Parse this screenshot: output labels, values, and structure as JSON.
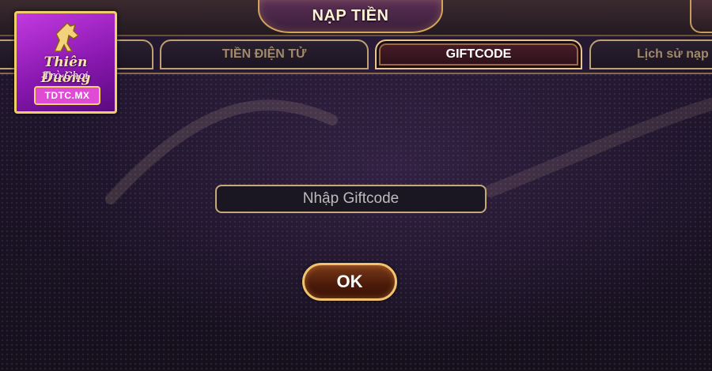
{
  "header": {
    "title": "NẠP TIỀN"
  },
  "tabs": [
    {
      "label": ""
    },
    {
      "label": "TIỀN ĐIỆN TỬ"
    },
    {
      "label": "GIFTCODE",
      "active": true
    },
    {
      "label": "Lịch sử nạp"
    }
  ],
  "logo": {
    "brand": "Thiên Đường",
    "sub": "Trò Chơi",
    "domain": "TDTC.MX"
  },
  "giftcode": {
    "placeholder": "Nhập Giftcode",
    "value": "",
    "submit_label": "OK"
  },
  "colors": {
    "gold": "#d4a35a",
    "background": "#1a1221",
    "active_tab": "#4a1e2a",
    "logo_purple": "#a522c8"
  }
}
